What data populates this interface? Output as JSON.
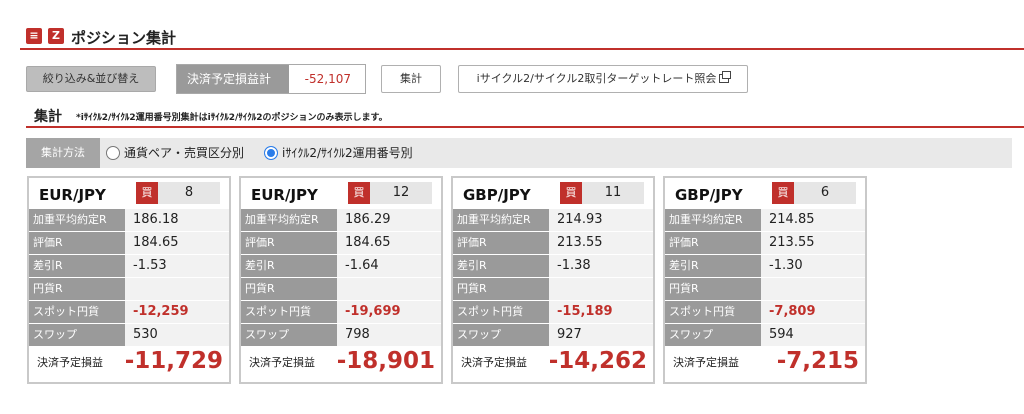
{
  "header": {
    "icon1": "≡",
    "icon2": "Z",
    "title": "ポジション集計"
  },
  "toolbar": {
    "filter_label": "絞り込み&並び替え",
    "pl_label": "決済予定損益計",
    "pl_value": "-52,107",
    "sum_label": "集計",
    "target_label": "iサイクル2/サイクル2取引ターゲットレート照会"
  },
  "section": {
    "title": "集計",
    "note": "*iｻｲｸﾙ2/ｻｲｸﾙ2運用番号別集計はiｻｲｸﾙ2/ｻｲｸﾙ2のポジションのみ表示します。"
  },
  "method": {
    "label": "集計方法",
    "option1": "通貨ペア・売買区分別",
    "option2": "iｻｲｸﾙ2/ｻｲｸﾙ2運用番号別",
    "selected": "option2"
  },
  "row_labels": {
    "avg_rate": "加重平均約定R",
    "eval_rate": "評価R",
    "diff_rate": "差引R",
    "yen_rate": "円貨R",
    "spot": "スポット円貨",
    "swap": "スワップ"
  },
  "total_label": "決済予定損益",
  "cards": [
    {
      "pair": "EUR/JPY",
      "side": "買",
      "qty": "8",
      "avg_rate": "186.18",
      "eval_rate": "184.65",
      "diff_rate": "-1.53",
      "yen_rate": "",
      "spot": "-12,259",
      "swap": "530",
      "total": "-11,729"
    },
    {
      "pair": "EUR/JPY",
      "side": "買",
      "qty": "12",
      "avg_rate": "186.29",
      "eval_rate": "184.65",
      "diff_rate": "-1.64",
      "yen_rate": "",
      "spot": "-19,699",
      "swap": "798",
      "total": "-18,901"
    },
    {
      "pair": "GBP/JPY",
      "side": "買",
      "qty": "11",
      "avg_rate": "214.93",
      "eval_rate": "213.55",
      "diff_rate": "-1.38",
      "yen_rate": "",
      "spot": "-15,189",
      "swap": "927",
      "total": "-14,262"
    },
    {
      "pair": "GBP/JPY",
      "side": "買",
      "qty": "6",
      "avg_rate": "214.85",
      "eval_rate": "213.55",
      "diff_rate": "-1.30",
      "yen_rate": "",
      "spot": "-7,809",
      "swap": "594",
      "total": "-7,215"
    }
  ],
  "colors": {
    "accent_red": "#c0302b",
    "label_gray": "#9a9a9a",
    "radio_blue": "#2b7de9"
  }
}
